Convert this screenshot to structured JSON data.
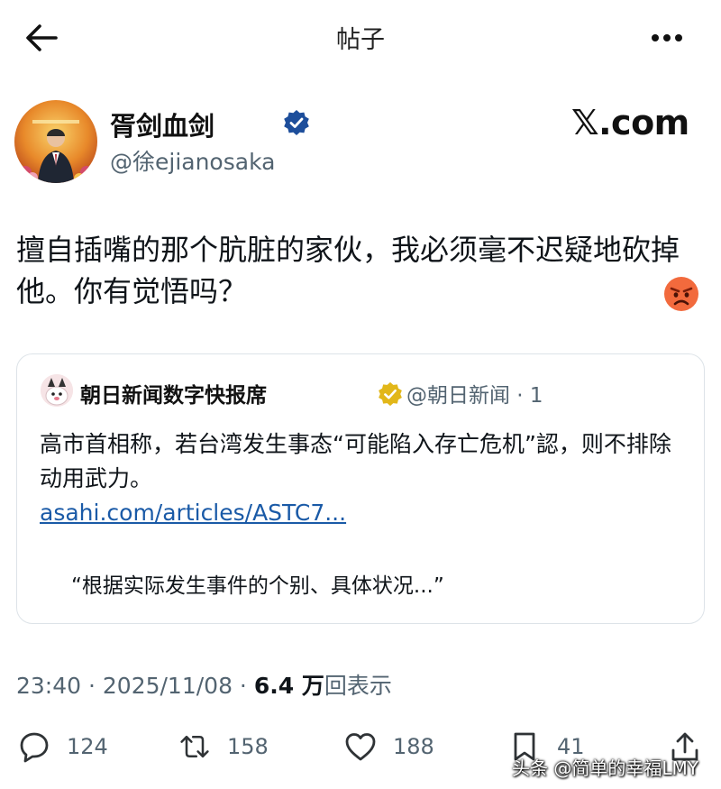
{
  "topbar": {
    "title": "帖子",
    "back_icon": "arrow-left-icon",
    "more_icon": "more-horizontal-icon"
  },
  "post": {
    "author": {
      "display_name": "胥剑血剑",
      "handle": "@徐ejianosaka",
      "verified": true,
      "verified_color": "#1d9bf0"
    },
    "brand": "𝕏.com",
    "text": "擅自插嘴的那个肮脏的家伙，我必须毫不迟疑地砍掉他。你有觉悟吗？",
    "emoji": "angry-face-icon",
    "quote": {
      "name": "朝日新闻数字快报席",
      "handle": "@朝日新闻 · 1",
      "badge_color": "#e2b719",
      "text": "高市首相称，若台湾发生事态“可能陷入存亡危机”認，则不排除动用武力。",
      "link": "asahi.com/articles/ASTC7...",
      "excerpt": "“根据实际发生事件的个别、具体状况...”"
    },
    "time": "23:40 · 2025/11/08 · ",
    "views_count": "6.4 万",
    "views_label": "回表示"
  },
  "actions": {
    "reply": {
      "icon": "reply-icon",
      "count": "124"
    },
    "retweet": {
      "icon": "retweet-icon",
      "count": "158"
    },
    "like": {
      "icon": "heart-icon",
      "count": "188"
    },
    "bookmark": {
      "icon": "bookmark-icon",
      "count": "41"
    },
    "share": {
      "icon": "share-icon"
    }
  },
  "watermark": "头条 @简单的幸福LMY"
}
